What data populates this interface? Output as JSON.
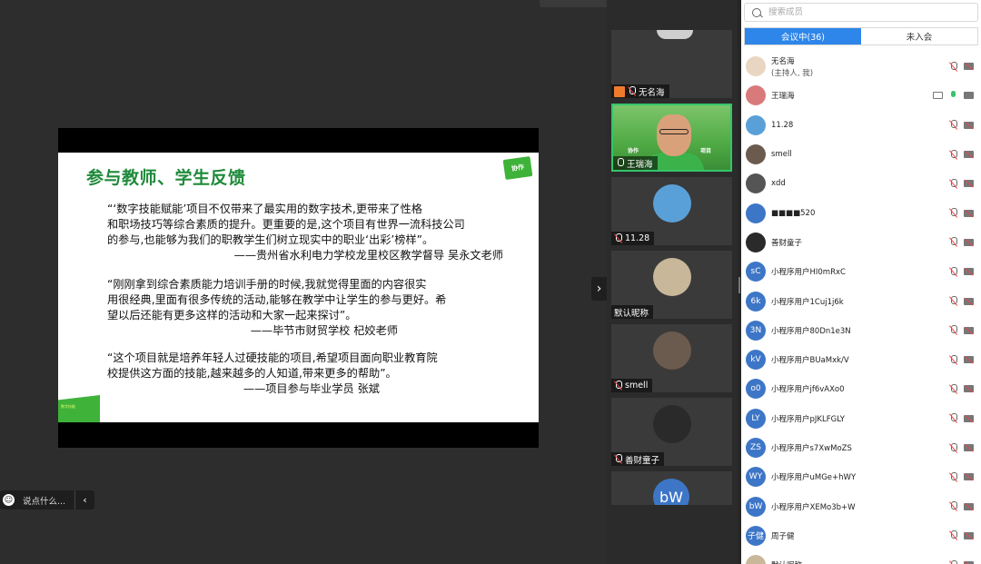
{
  "slide": {
    "title": "参与教师、学生反馈",
    "logo_text": "协作",
    "quotes": [
      {
        "lines": [
          "“‘数字技能赋能’项目不仅带来了最实用的数字技术,更带来了性格",
          "和职场技巧等综合素质的提升。更重要的是,这个项目有世界一流科技公司",
          "的参与,也能够为我们的职教学生们树立现实中的职业‘出彩’榜样”。"
        ],
        "signature": "——贵州省水利电力学校龙里校区教学督导 吴永文老师"
      },
      {
        "lines": [
          "“刚刚拿到综合素质能力培训手册的时候,我就觉得里面的内容很实",
          "用很经典,里面有很多传统的活动,能够在教学中让学生的参与更好。希",
          "望以后还能有更多这样的活动和大家一起来探讨”。"
        ],
        "signature": "——毕节市财贸学校 杞姣老师"
      },
      {
        "lines": [
          "“这个项目就是培养年轻人过硬技能的项目,希望项目面向职业教育院",
          "校提供这方面的技能,越来越多的人知道,带来更多的帮助”。"
        ],
        "signature": "——项目参与毕业学员 张斌"
      }
    ],
    "footer_text": "数字技能"
  },
  "chat": {
    "placeholder": "说点什么..."
  },
  "video_tiles": [
    {
      "name": "无名海"
    },
    {
      "name": "王瑞海",
      "sign_left": "协作",
      "sign_right": "项目"
    },
    {
      "name": "11.28"
    },
    {
      "name": "默认昵称"
    },
    {
      "name": "smell"
    },
    {
      "name": "善财童子"
    },
    {
      "name": "bW",
      "initials": "bW"
    }
  ],
  "panel": {
    "search_placeholder": "搜索成员",
    "tabs": [
      "会议中(36)",
      "未入会"
    ],
    "members": [
      {
        "name": "无名海",
        "sub": "(主持人, 我)",
        "avatar": "",
        "avatar_color": "#e9d6c2",
        "icons": [
          "mic-muted",
          "cam-off"
        ]
      },
      {
        "name": "王瑞海",
        "avatar": "",
        "avatar_color": "#d97a7a",
        "icons": [
          "screen",
          "mic-active",
          "cam-on"
        ]
      },
      {
        "name": "11.28",
        "avatar": "",
        "avatar_color": "#5aa0d8",
        "icons": [
          "mic-muted",
          "cam-off"
        ]
      },
      {
        "name": "smell",
        "avatar": "",
        "avatar_color": "#6b5a4e",
        "icons": [
          "mic-muted",
          "cam-off"
        ]
      },
      {
        "name": "xdd",
        "avatar": "",
        "avatar_color": "#555555",
        "icons": [
          "mic-muted",
          "cam-off"
        ]
      },
      {
        "name": "■■■■520",
        "avatar": "",
        "avatar_color": "#3d76c7",
        "icons": [
          "mic-muted",
          "cam-off"
        ]
      },
      {
        "name": "善财童子",
        "avatar": "",
        "avatar_color": "#2a2a2a",
        "icons": [
          "mic-muted",
          "cam-off"
        ]
      },
      {
        "name": "小程序用户HI0mRxC",
        "avatar": "sC",
        "avatar_color": "#3d76c7",
        "icons": [
          "mic-muted",
          "cam-off"
        ]
      },
      {
        "name": "小程序用户1Cuj1j6k",
        "avatar": "6k",
        "avatar_color": "#3d76c7",
        "icons": [
          "mic-muted",
          "cam-off"
        ]
      },
      {
        "name": "小程序用户80Dn1e3N",
        "avatar": "3N",
        "avatar_color": "#3d76c7",
        "icons": [
          "mic-muted",
          "cam-off"
        ]
      },
      {
        "name": "小程序用户BUaMxk/V",
        "avatar": "kV",
        "avatar_color": "#3d76c7",
        "icons": [
          "mic-muted",
          "cam-off"
        ]
      },
      {
        "name": "小程序用户jf6vAXo0",
        "avatar": "o0",
        "avatar_color": "#3d76c7",
        "icons": [
          "mic-muted",
          "cam-off"
        ]
      },
      {
        "name": "小程序用户pJKLFGLY",
        "avatar": "LY",
        "avatar_color": "#3d76c7",
        "icons": [
          "mic-muted",
          "cam-off"
        ]
      },
      {
        "name": "小程序用户s7XwMoZS",
        "avatar": "ZS",
        "avatar_color": "#3d76c7",
        "icons": [
          "mic-muted",
          "cam-off"
        ]
      },
      {
        "name": "小程序用户uMGe+hWY",
        "avatar": "WY",
        "avatar_color": "#3d76c7",
        "icons": [
          "mic-muted",
          "cam-off"
        ]
      },
      {
        "name": "小程序用户XEMo3b+W",
        "avatar": "bW",
        "avatar_color": "#3d76c7",
        "icons": [
          "mic-muted",
          "cam-off"
        ]
      },
      {
        "name": "周子健",
        "avatar": "子健",
        "avatar_color": "#3d76c7",
        "icons": [
          "mic-muted",
          "cam-off"
        ]
      },
      {
        "name": "默认昵称",
        "avatar": "",
        "avatar_color": "#c9b79a",
        "icons": [
          "mic-muted",
          "cam-off"
        ]
      }
    ]
  }
}
